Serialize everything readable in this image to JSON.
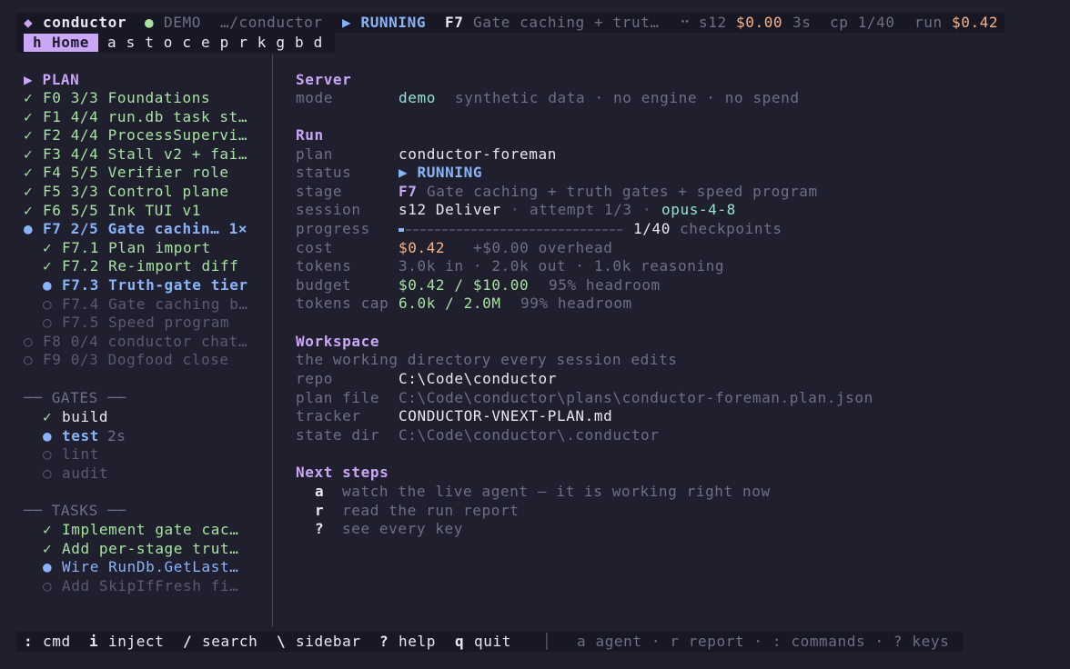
{
  "header": {
    "diamond": "◆",
    "app_name": "conductor",
    "mode_dot": "●",
    "mode_label": "DEMO",
    "path": "…/conductor",
    "status": "▶ RUNNING",
    "phase_id": "F7",
    "phase_title": "Gate caching + trut…",
    "session_icon": "⠒",
    "session": "s12",
    "session_cost": "$0.00",
    "session_time": "3s",
    "checkpoint": "cp 1/40",
    "run_label": "run",
    "run_cost": "$0.42"
  },
  "tabs": {
    "home_key": "h",
    "home_label": "Home",
    "shortcut_keys": [
      "a",
      "s",
      "t",
      "o",
      "c",
      "e",
      "p",
      "r",
      "k",
      "g",
      "b",
      "d"
    ]
  },
  "sidebar": {
    "plan_heading": "▶ PLAN",
    "plan_items": [
      {
        "icon": "✓",
        "text": "F0 3/3 Foundations",
        "state": "done"
      },
      {
        "icon": "✓",
        "text": "F1 4/4 run.db task st…",
        "state": "done"
      },
      {
        "icon": "✓",
        "text": "F2 4/4 ProcessSupervi…",
        "state": "done"
      },
      {
        "icon": "✓",
        "text": "F3 4/4 Stall v2 + fai…",
        "state": "done"
      },
      {
        "icon": "✓",
        "text": "F4 5/5 Verifier role",
        "state": "done"
      },
      {
        "icon": "✓",
        "text": "F5 3/3 Control plane",
        "state": "done"
      },
      {
        "icon": "✓",
        "text": "F6 5/5 Ink TUI v1",
        "state": "done"
      },
      {
        "icon": "●",
        "text": "F7 2/5 Gate cachin… 1×",
        "state": "active"
      },
      {
        "icon": "✓",
        "text": "F7.1 Plan import",
        "state": "sub-done"
      },
      {
        "icon": "✓",
        "text": "F7.2 Re-import diff",
        "state": "sub-done"
      },
      {
        "icon": "●",
        "text": "F7.3 Truth-gate tier",
        "state": "sub-active"
      },
      {
        "icon": "○",
        "text": "F7.4 Gate caching b…",
        "state": "sub-pending"
      },
      {
        "icon": "○",
        "text": "F7.5 Speed program",
        "state": "sub-pending"
      },
      {
        "icon": "○",
        "text": "F8 0/4 conductor chat…",
        "state": "pending"
      },
      {
        "icon": "○",
        "text": "F9 0/3 Dogfood close",
        "state": "pending"
      }
    ],
    "gates_heading": "── GATES ──",
    "gates": [
      {
        "icon": "✓",
        "name": "build",
        "extra": "",
        "state": "done"
      },
      {
        "icon": "●",
        "name": "test",
        "extra": "2s",
        "state": "active"
      },
      {
        "icon": "○",
        "name": "lint",
        "extra": "",
        "state": "pending"
      },
      {
        "icon": "○",
        "name": "audit",
        "extra": "",
        "state": "pending"
      }
    ],
    "tasks_heading": "── TASKS ──",
    "tasks": [
      {
        "icon": "✓",
        "text": "Implement gate cac…",
        "state": "done"
      },
      {
        "icon": "✓",
        "text": "Add per-stage trut…",
        "state": "done"
      },
      {
        "icon": "●",
        "text": "Wire RunDb.GetLast…",
        "state": "active"
      },
      {
        "icon": "○",
        "text": "Add SkipIfFresh fi…",
        "state": "pending"
      }
    ]
  },
  "main": {
    "server": {
      "heading": "Server",
      "mode_label": "mode",
      "mode_value": "demo",
      "mode_note": "synthetic data · no engine · no spend"
    },
    "run": {
      "heading": "Run",
      "plan_label": "plan",
      "plan_value": "conductor-foreman",
      "status_label": "status",
      "status_value": "▶ RUNNING",
      "stage_label": "stage",
      "stage_id": "F7",
      "stage_title": "Gate caching + truth gates + speed program",
      "session_label": "session",
      "session_value": "s12 Deliver",
      "session_sep1": "·",
      "session_attempt": "attempt 1/3",
      "session_sep2": "·",
      "session_model": "opus-4-8",
      "progress_label": "progress",
      "progress_fraction": 0.025,
      "progress_value": "1/40",
      "progress_unit": "checkpoints",
      "cost_label": "cost",
      "cost_value": "$0.42",
      "cost_overhead": "+$0.00 overhead",
      "tokens_label": "tokens",
      "tokens_value": "3.0k in · 2.0k out · 1.0k reasoning",
      "budget_label": "budget",
      "budget_value": "$0.42 / $10.00",
      "budget_headroom": "95% headroom",
      "tokcap_label": "tokens cap",
      "tokcap_value": "6.0k / 2.0M",
      "tokcap_headroom": "99% headroom"
    },
    "workspace": {
      "heading": "Workspace",
      "subtitle": "the working directory every session edits",
      "repo_label": "repo",
      "repo_value": "C:\\Code\\conductor",
      "planfile_label": "plan file",
      "planfile_value": "C:\\Code\\conductor\\plans\\conductor-foreman.plan.json",
      "tracker_label": "tracker",
      "tracker_value": "CONDUCTOR-VNEXT-PLAN.md",
      "statedir_label": "state dir",
      "statedir_value": "C:\\Code\\conductor\\.conductor"
    },
    "next_steps": {
      "heading": "Next steps",
      "items": [
        {
          "key": "a",
          "text": "watch the live agent — it is working right now"
        },
        {
          "key": "r",
          "text": "read the run report"
        },
        {
          "key": "?",
          "text": "see every key"
        }
      ]
    }
  },
  "footer": {
    "commands": [
      {
        "key": ":",
        "label": "cmd"
      },
      {
        "key": "i",
        "label": "inject"
      },
      {
        "key": "/",
        "label": "search"
      },
      {
        "key": "\\",
        "label": "sidebar"
      },
      {
        "key": "?",
        "label": "help"
      },
      {
        "key": "q",
        "label": "quit"
      }
    ],
    "separator": "│",
    "hint": "a agent · r report · : commands · ? keys"
  },
  "colors": {
    "background": "#1f1f2e",
    "accent_purple": "#cba6f7",
    "accent_blue": "#89b4fa",
    "done_green": "#a6e3a1",
    "cost_peach": "#fab387",
    "dim": "#6c7086"
  }
}
